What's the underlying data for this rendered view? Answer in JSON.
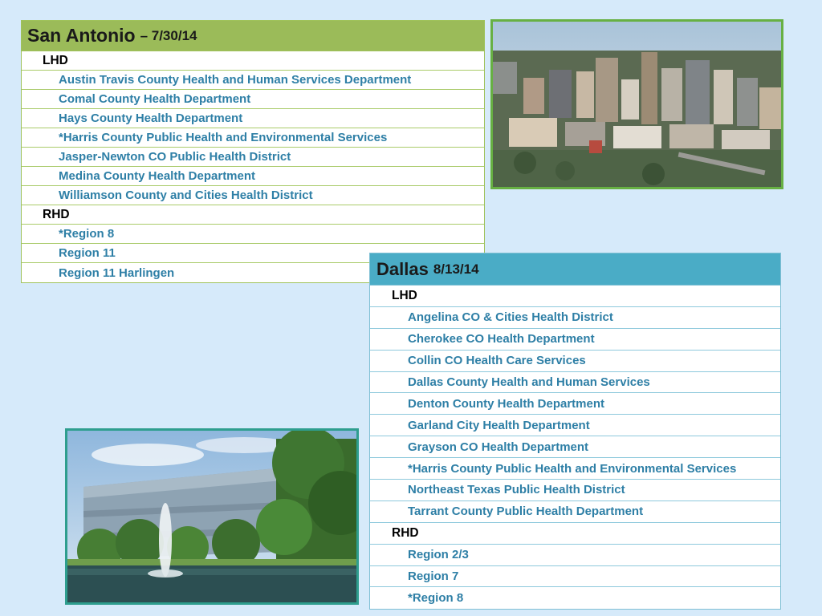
{
  "san_antonio": {
    "city": "San Antonio",
    "date": "– 7/30/14",
    "lhd_label": "LHD",
    "lhd": [
      "Austin Travis County Health and Human Services Department",
      "Comal County Health Department",
      "Hays County Health Department",
      "*Harris County Public Health and Environmental Services",
      "Jasper-Newton CO Public Health District",
      "Medina County Health Department",
      "Williamson County and Cities Health District"
    ],
    "rhd_label": "RHD",
    "rhd": [
      "*Region 8",
      "Region 11",
      "Region 11 Harlingen"
    ]
  },
  "dallas": {
    "city": "Dallas",
    "date": "8/13/14",
    "lhd_label": "LHD",
    "lhd": [
      "Angelina CO & Cities Health District",
      "Cherokee CO Health Department",
      "Collin CO Health Care Services",
      "Dallas County Health and Human Services",
      "Denton County Health Department",
      "Garland City Health Department",
      "Grayson CO Health Department",
      "*Harris County Public Health and Environmental Services",
      "Northeast Texas Public Health District",
      "Tarrant County Public Health Department"
    ],
    "rhd_label": "RHD",
    "rhd": [
      "Region 2/3",
      "Region 7",
      "*Region 8"
    ]
  },
  "colors": {
    "background": "#d6eafa",
    "san_antonio_header": "#9bbb59",
    "dallas_header": "#4aacc6",
    "item_text": "#2e7fa6"
  }
}
